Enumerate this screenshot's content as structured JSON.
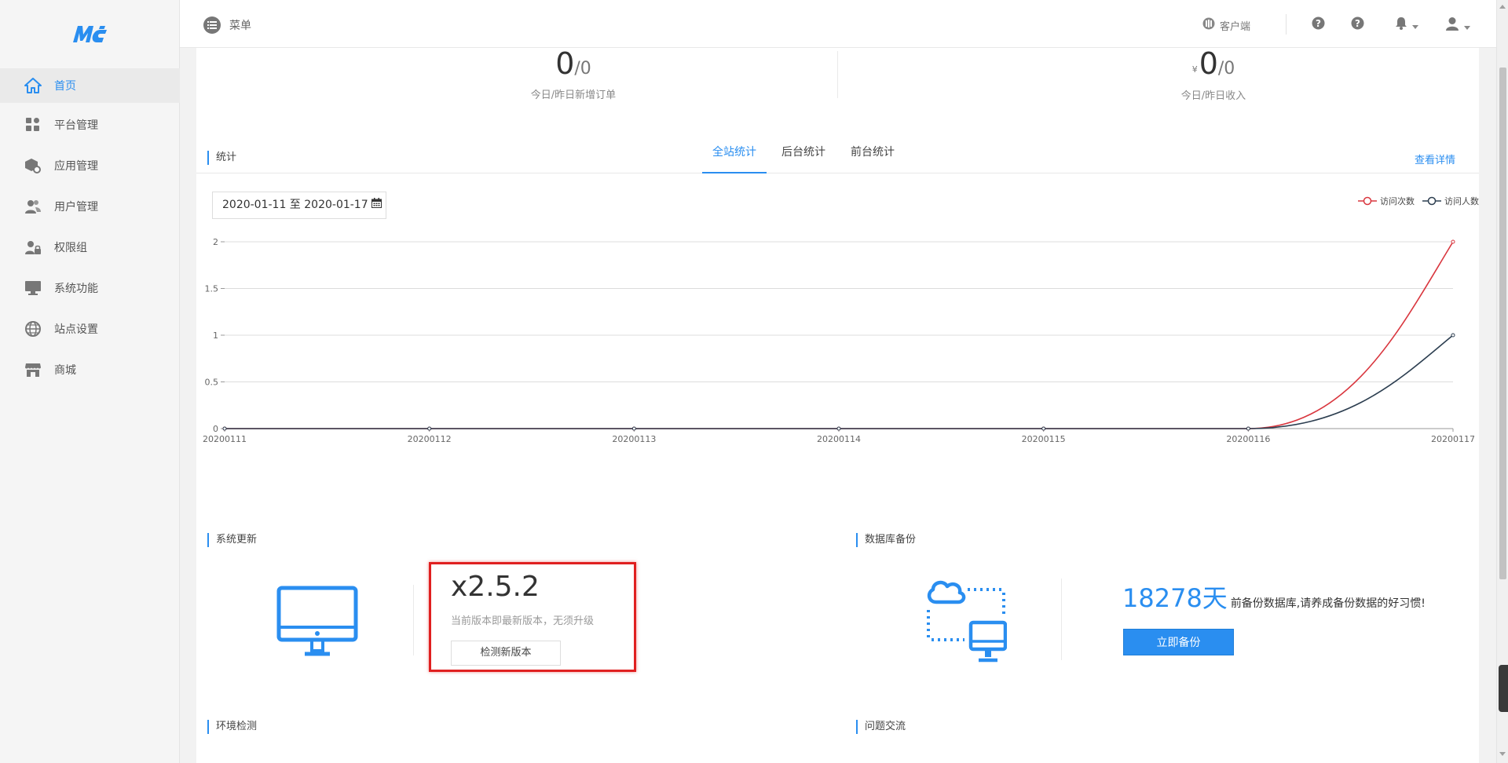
{
  "brand": {
    "logo_text": "MC"
  },
  "sidebar": {
    "items": [
      {
        "label": "首页",
        "icon": "home-icon",
        "active": true
      },
      {
        "label": "平台管理",
        "icon": "grid-icon"
      },
      {
        "label": "应用管理",
        "icon": "box-gear-icon"
      },
      {
        "label": "用户管理",
        "icon": "users-icon"
      },
      {
        "label": "权限组",
        "icon": "user-lock-icon"
      },
      {
        "label": "系统功能",
        "icon": "monitor-icon"
      },
      {
        "label": "站点设置",
        "icon": "globe-icon"
      },
      {
        "label": "商城",
        "icon": "store-icon"
      }
    ]
  },
  "header": {
    "menu_label": "菜单",
    "client_label": "客户端"
  },
  "summary": {
    "orders_today": "0",
    "orders_yesterday": "/0",
    "orders_caption": "今日/昨日新增订单",
    "currency": "¥",
    "income_today": "0",
    "income_yesterday": "/0",
    "income_caption": "今日/昨日收入"
  },
  "stats": {
    "title": "统计",
    "tabs": [
      "全站统计",
      "后台统计",
      "前台统计"
    ],
    "active_tab": 0,
    "view_detail": "查看详情",
    "date_range": "2020-01-11 至 2020-01-17"
  },
  "chart_data": {
    "type": "line",
    "categories": [
      "20200111",
      "20200112",
      "20200113",
      "20200114",
      "20200115",
      "20200116",
      "20200117"
    ],
    "series": [
      {
        "name": "访问次数",
        "values": [
          0,
          0,
          0,
          0,
          0,
          0,
          2
        ],
        "color": "#d9363e"
      },
      {
        "name": "访问人数",
        "values": [
          0,
          0,
          0,
          0,
          0,
          0,
          1
        ],
        "color": "#2c3e50"
      }
    ],
    "yticks": [
      "0",
      "0.5",
      "1",
      "1.5",
      "2"
    ],
    "ylim": [
      0,
      2
    ],
    "grid": true,
    "legend_position": "top-right"
  },
  "update": {
    "title": "系统更新",
    "version": "x2.5.2",
    "desc": "当前版本即最新版本，无须升级",
    "check_button": "检测新版本"
  },
  "backup": {
    "title": "数据库备份",
    "days": "18278天",
    "message": "前备份数据库,请养成备份数据的好习惯!",
    "button": "立即备份"
  },
  "lower": {
    "env_title": "环境检测",
    "qa_title": "问题交流"
  },
  "colors": {
    "accent": "#2a8ef0",
    "highlight": "#e02020"
  }
}
